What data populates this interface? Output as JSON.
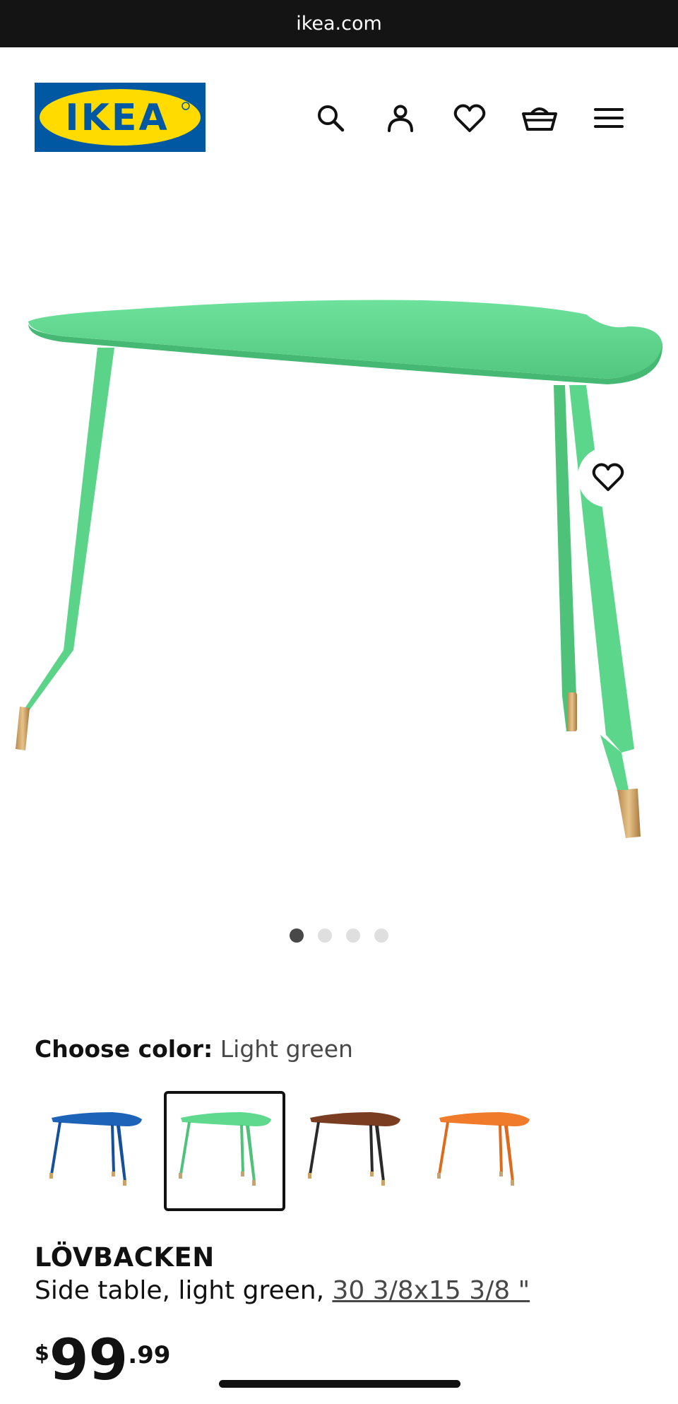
{
  "browser": {
    "url": "ikea.com"
  },
  "header": {
    "logo_text": "IKEA",
    "icons": [
      "search-icon",
      "profile-icon",
      "heart-icon",
      "basket-icon",
      "menu-icon"
    ]
  },
  "gallery": {
    "image_count": 4,
    "active_index": 0
  },
  "color_picker": {
    "label": "Choose color:",
    "selected": "Light green",
    "options": [
      {
        "color": "#1d63b8"
      },
      {
        "color": "#5fd98e",
        "selected": true
      },
      {
        "color": "#7a3d22"
      },
      {
        "color": "#f07c2b"
      }
    ]
  },
  "product": {
    "name": "LÖVBACKEN",
    "description": "Side table, light green,",
    "dimensions": "30 3/8x15 3/8 \"",
    "price": {
      "currency": "$",
      "integer": "99",
      "decimal": ".99"
    }
  },
  "colors": {
    "brand_blue": "#0058a3",
    "brand_yellow": "#ffdb00",
    "table_green": "#5fd98e",
    "brass": "#c9a36a"
  }
}
